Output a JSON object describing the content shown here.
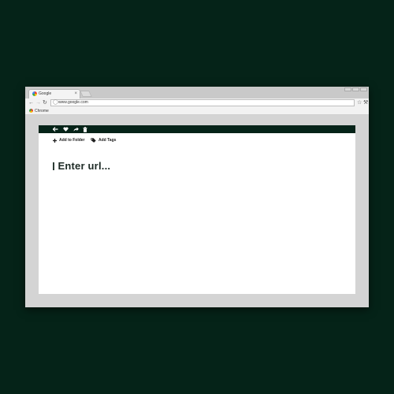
{
  "browser": {
    "tab_title": "Google",
    "tab_close": "×",
    "url": "www.google.com",
    "bookmark": "Chrome"
  },
  "app": {
    "toolbar_icons": [
      "back-arrow-icon",
      "heart-icon",
      "share-icon",
      "trash-icon"
    ],
    "add_to_folder_label": "Add to Folder",
    "add_tags_label": "Add Tags",
    "url_placeholder": "Enter url..."
  },
  "colors": {
    "background": "#052318",
    "accent": "#052318",
    "page": "#ffffff",
    "frame": "#d4d4d4"
  }
}
